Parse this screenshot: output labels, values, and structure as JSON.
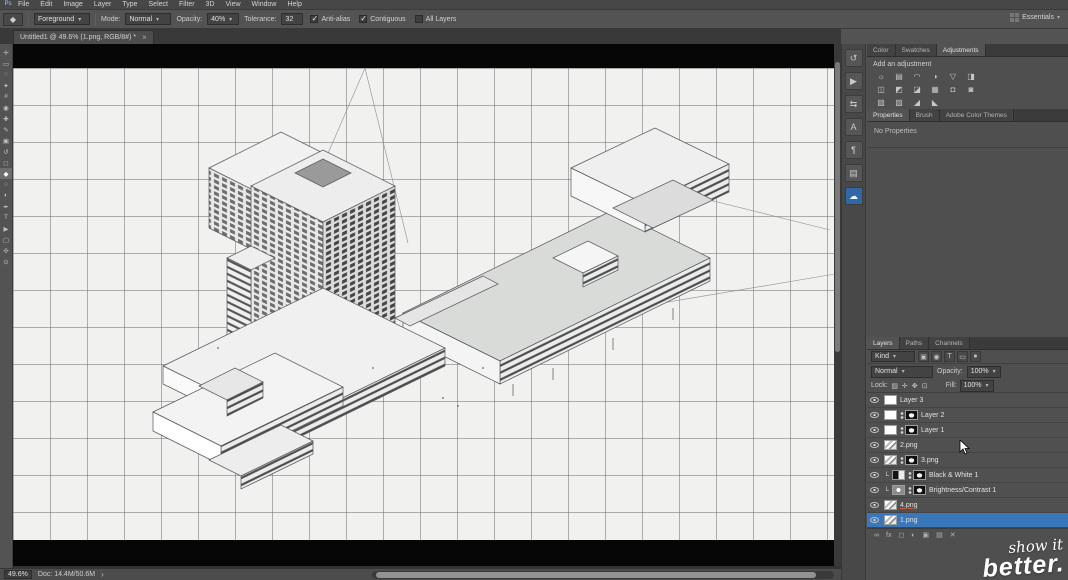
{
  "menubar": {
    "app_icon": "Ps",
    "items": [
      "File",
      "Edit",
      "Image",
      "Layer",
      "Type",
      "Select",
      "Filter",
      "3D",
      "View",
      "Window",
      "Help"
    ]
  },
  "options": {
    "tool_glyph": "◆",
    "fill_source": "Foreground",
    "mode_label": "Mode:",
    "mode_value": "Normal",
    "opacity_label": "Opacity:",
    "opacity_value": "40%",
    "tolerance_label": "Tolerance:",
    "tolerance_value": "32",
    "checks": [
      {
        "label": "Anti-alias",
        "cls": "checked"
      },
      {
        "label": "Contiguous",
        "cls": "checked"
      },
      {
        "label": "All Layers",
        "cls": ""
      }
    ],
    "workspace": "Essentials"
  },
  "document_tab": {
    "title": "Untitled1 @ 49.6% (1.png, RGB/8#) *",
    "close_glyph": "×"
  },
  "toolbar": {
    "tools": [
      {
        "name": "move-tool",
        "glyph": "✛",
        "cls": ""
      },
      {
        "name": "marquee-tool",
        "glyph": "▭",
        "cls": ""
      },
      {
        "name": "lasso-tool",
        "glyph": "◌",
        "cls": ""
      },
      {
        "name": "magic-wand-tool",
        "glyph": "✦",
        "cls": ""
      },
      {
        "name": "crop-tool",
        "glyph": "#",
        "cls": ""
      },
      {
        "name": "eyedropper-tool",
        "glyph": "◉",
        "cls": ""
      },
      {
        "name": "healing-brush-tool",
        "glyph": "✚",
        "cls": ""
      },
      {
        "name": "brush-tool",
        "glyph": "✎",
        "cls": ""
      },
      {
        "name": "clone-stamp-tool",
        "glyph": "▣",
        "cls": ""
      },
      {
        "name": "history-brush-tool",
        "glyph": "↺",
        "cls": ""
      },
      {
        "name": "eraser-tool",
        "glyph": "◻",
        "cls": ""
      },
      {
        "name": "paint-bucket-tool",
        "glyph": "◆",
        "cls": "active"
      },
      {
        "name": "blur-tool",
        "glyph": "○",
        "cls": ""
      },
      {
        "name": "dodge-tool",
        "glyph": "◐",
        "cls": ""
      },
      {
        "name": "pen-tool",
        "glyph": "✒",
        "cls": ""
      },
      {
        "name": "type-tool",
        "glyph": "T",
        "cls": ""
      },
      {
        "name": "path-select-tool",
        "glyph": "▶",
        "cls": ""
      },
      {
        "name": "shape-tool",
        "glyph": "▢",
        "cls": ""
      },
      {
        "name": "hand-tool",
        "glyph": "✣",
        "cls": ""
      },
      {
        "name": "zoom-tool",
        "glyph": "⊙",
        "cls": ""
      }
    ]
  },
  "dock": {
    "icons": [
      {
        "name": "history-icon",
        "glyph": "↺",
        "cls": ""
      },
      {
        "name": "actions-icon",
        "glyph": "▶",
        "cls": ""
      },
      {
        "name": "export-icon",
        "glyph": "⇆",
        "cls": ""
      },
      {
        "name": "character-icon",
        "glyph": "A",
        "cls": ""
      },
      {
        "name": "paragraph-icon",
        "glyph": "¶",
        "cls": ""
      },
      {
        "name": "glyphs-icon",
        "glyph": "▤",
        "cls": ""
      },
      {
        "name": "libraries-icon",
        "glyph": "☁",
        "cls": "active"
      }
    ]
  },
  "panels": {
    "color_tabs": [
      {
        "label": "Color",
        "cls": ""
      },
      {
        "label": "Swatches",
        "cls": ""
      },
      {
        "label": "Adjustments",
        "cls": "active"
      }
    ],
    "adjustments": {
      "header": "Add an adjustment",
      "icons": [
        {
          "name": "brightness-contrast-icon",
          "glyph": "☼"
        },
        {
          "name": "levels-icon",
          "glyph": "▤"
        },
        {
          "name": "curves-icon",
          "glyph": "◠"
        },
        {
          "name": "exposure-icon",
          "glyph": "◑"
        },
        {
          "name": "vibrance-icon",
          "glyph": "▽"
        },
        {
          "name": "hue-saturation-icon",
          "glyph": "◨"
        },
        {
          "name": "color-balance-icon",
          "glyph": "◫"
        },
        {
          "name": "black-white-icon",
          "glyph": "◩"
        },
        {
          "name": "photo-filter-icon",
          "glyph": "◪"
        },
        {
          "name": "channel-mixer-icon",
          "glyph": "▦"
        },
        {
          "name": "color-lookup-icon",
          "glyph": "◘"
        },
        {
          "name": "invert-icon",
          "glyph": "◙"
        },
        {
          "name": "posterize-icon",
          "glyph": "▧"
        },
        {
          "name": "threshold-icon",
          "glyph": "▨"
        },
        {
          "name": "gradient-map-icon",
          "glyph": "◢"
        },
        {
          "name": "selective-color-icon",
          "glyph": "◣"
        }
      ]
    },
    "prop_tabs": [
      {
        "label": "Properties",
        "cls": "active"
      },
      {
        "label": "Brush",
        "cls": ""
      },
      {
        "label": "Adobe Color Themes",
        "cls": ""
      }
    ],
    "properties": {
      "empty": "No Properties"
    },
    "layer_tabs": [
      {
        "label": "Layers",
        "cls": "active"
      },
      {
        "label": "Paths",
        "cls": ""
      },
      {
        "label": "Channels",
        "cls": ""
      }
    ]
  },
  "layers_panel": {
    "filter": {
      "label": "Kind",
      "icons": [
        {
          "name": "filter-pixel-icon",
          "glyph": "▣"
        },
        {
          "name": "filter-adjustment-icon",
          "glyph": "◉"
        },
        {
          "name": "filter-type-icon",
          "glyph": "T"
        },
        {
          "name": "filter-shape-icon",
          "glyph": "▭"
        },
        {
          "name": "filter-smart-icon",
          "glyph": "●"
        }
      ]
    },
    "blend": {
      "value": "Normal",
      "opacity_label": "Opacity:",
      "opacity_value": "100%"
    },
    "lock": {
      "label": "Lock:",
      "icons": [
        {
          "name": "lock-transparency-icon",
          "glyph": "▨"
        },
        {
          "name": "lock-pixels-icon",
          "glyph": "✛"
        },
        {
          "name": "lock-position-icon",
          "glyph": "✥"
        },
        {
          "name": "lock-all-icon",
          "glyph": "⊡"
        }
      ],
      "fill_label": "Fill:",
      "fill_value": "100%"
    },
    "layers": [
      {
        "name": "Layer 3",
        "thumb": "th-white",
        "row_class": "",
        "name_class": ""
      },
      {
        "name": "Layer 2",
        "thumb": "th-white",
        "has_mask": true,
        "row_class": "",
        "name_class": ""
      },
      {
        "name": "Layer 1",
        "thumb": "th-white",
        "has_mask": true,
        "row_class": "",
        "name_class": ""
      },
      {
        "name": "2.png",
        "thumb": "th-img",
        "row_class": "",
        "name_class": ""
      },
      {
        "name": "3.png",
        "thumb": "th-img",
        "has_mask": true,
        "row_class": "",
        "name_class": ""
      },
      {
        "name": "Black & White 1",
        "thumb": "th-bw",
        "has_mask": true,
        "clipped": true,
        "row_class": "",
        "name_class": ""
      },
      {
        "name": "Brightness/Contrast 1",
        "thumb": "th-bc",
        "has_mask": true,
        "clipped": true,
        "row_class": "",
        "name_class": ""
      },
      {
        "name": "4.png",
        "thumb": "th-img",
        "row_class": "",
        "name_class": "underlined"
      },
      {
        "name": "1.png",
        "thumb": "th-img",
        "row_class": "selected",
        "name_class": ""
      }
    ],
    "footer_icons": [
      {
        "name": "link-layers-icon",
        "glyph": "∞"
      },
      {
        "name": "layer-effects-icon",
        "glyph": "fx"
      },
      {
        "name": "add-mask-icon",
        "glyph": "◻"
      },
      {
        "name": "new-adjustment-icon",
        "glyph": "◐"
      },
      {
        "name": "new-group-icon",
        "glyph": "▣"
      },
      {
        "name": "new-layer-icon",
        "glyph": "▤"
      },
      {
        "name": "delete-layer-icon",
        "glyph": "✕"
      }
    ]
  },
  "status": {
    "zoom": "49.6%",
    "doc": "Doc: 14.4M/50.6M",
    "chevron": "›"
  },
  "watermark": {
    "line1": "show it",
    "line2": "better."
  }
}
